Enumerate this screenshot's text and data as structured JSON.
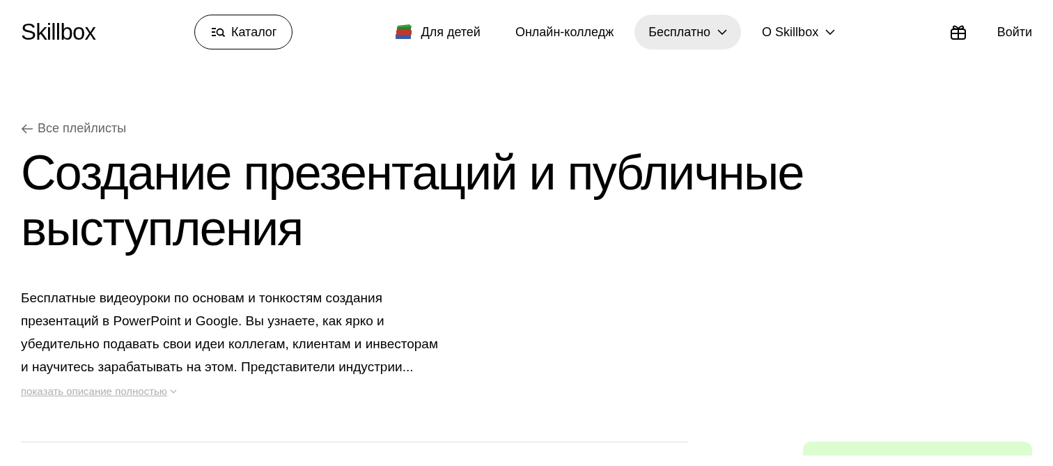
{
  "header": {
    "logo": "Skillbox",
    "catalog_button": "Каталог",
    "nav": [
      {
        "label": "Для детей",
        "kind": "kids",
        "selected": false
      },
      {
        "label": "Онлайн-колледж",
        "kind": "link",
        "selected": false
      },
      {
        "label": "Бесплатно",
        "kind": "menu",
        "selected": true
      },
      {
        "label": "O Skillbox",
        "kind": "menu",
        "selected": false
      }
    ],
    "login": "Войти"
  },
  "back_link": "Все плейлисты",
  "title": "Создание презентаций и публичные выступления",
  "description": "Бесплатные видеоуроки по основам и тонкостям создания презентаций в PowerPoint и Google. Вы узнаете, как ярко и убедительно подавать свои идеи коллегам, клиентам и инвесторам и научитесь зарабатывать на этом. Представители индустрии...",
  "show_more": "показать описание полностью"
}
